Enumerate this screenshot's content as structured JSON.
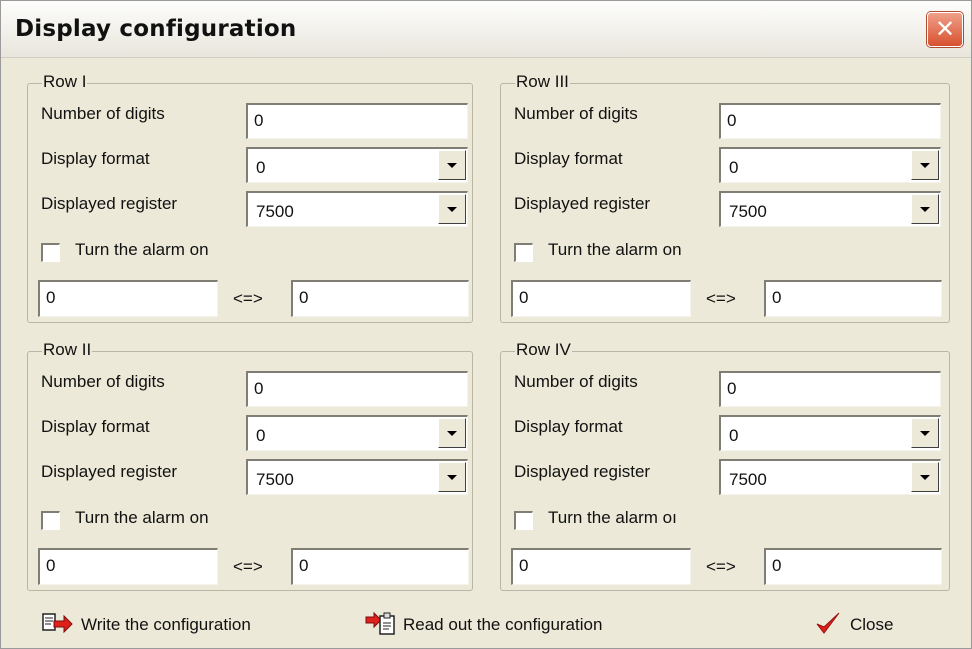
{
  "window": {
    "title": "Display configuration",
    "close_glyph": "✕"
  },
  "labels": {
    "digits": "Number of digits",
    "format": "Display format",
    "register": "Displayed register",
    "compare": "<=>"
  },
  "rows": [
    {
      "legend": "Row I",
      "digits": "0",
      "format": "0",
      "register": "7500",
      "alarm_label": "Turn the alarm on",
      "alarm_checked": false,
      "low": "0",
      "high": "0"
    },
    {
      "legend": "Row III",
      "digits": "0",
      "format": "0",
      "register": "7500",
      "alarm_label": "Turn the alarm on",
      "alarm_checked": false,
      "low": "0",
      "high": "0"
    },
    {
      "legend": "Row II",
      "digits": "0",
      "format": "0",
      "register": "7500",
      "alarm_label": "Turn the alarm on",
      "alarm_checked": false,
      "low": "0",
      "high": "0"
    },
    {
      "legend": "Row IV",
      "digits": "0",
      "format": "0",
      "register": "7500",
      "alarm_label": "Turn the alarm oı",
      "alarm_checked": false,
      "low": "0",
      "high": "0"
    }
  ],
  "buttons": {
    "write": "Write the configuration",
    "read": "Read out the configuration",
    "close": "Close"
  },
  "icons": {
    "write": "write-config-icon",
    "read": "read-config-icon",
    "close": "checkmark-icon",
    "accent": "#e0201a"
  }
}
